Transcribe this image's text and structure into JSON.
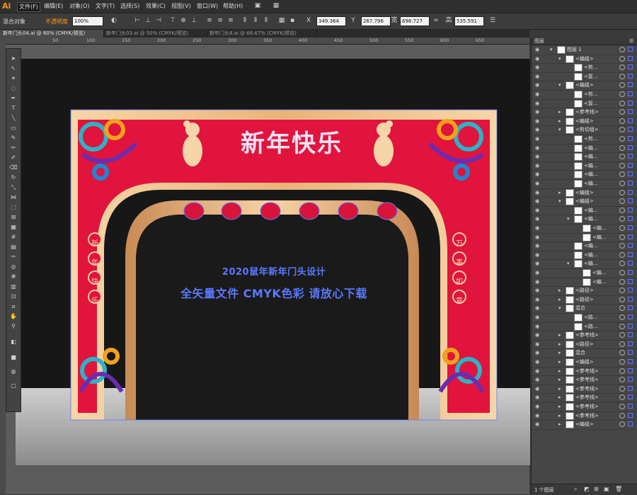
{
  "menubar": {
    "logo": "Ai",
    "items": [
      "文件(F)",
      "编辑(E)",
      "对象(O)",
      "文字(T)",
      "选择(S)",
      "效果(C)",
      "视图(V)",
      "窗口(W)",
      "帮助(H)"
    ]
  },
  "controlbar": {
    "selection_label": "混合对象",
    "opacity_label": "不透明度",
    "opacity_value": "100%",
    "x_label": "X",
    "x_value": "349.364",
    "y_label": "Y",
    "y_value": "267.796",
    "w_label": "宽",
    "w_value": "698.727",
    "h_label": "高",
    "h_value": "535.591"
  },
  "tabs": [
    "新年门头04.ai @ 60% (CMYK/预览)",
    "新年门头03.ai @ 50% (CMYK/预览)",
    "新年门头8.ai @ 66.67% (CMYK/预览)"
  ],
  "ruler": [
    "50",
    "100",
    "150",
    "200",
    "250",
    "300",
    "350",
    "400",
    "450",
    "500",
    "550",
    "600",
    "650"
  ],
  "artwork": {
    "title_text": "新年快乐",
    "left_couplet": [
      "新",
      "年",
      "快",
      "乐"
    ],
    "right_couplet": [
      "万",
      "事",
      "如",
      "意"
    ],
    "selection_line1": "2020鼠年新年门头设计",
    "selection_line2": "全矢量文件 CMYK色彩 请放心下载"
  },
  "layers_panel": {
    "title": "图层",
    "status": "1 个图层",
    "rows": [
      {
        "label": "图层 1",
        "indent": 0,
        "expanded": true
      },
      {
        "label": "<编组>",
        "indent": 1,
        "expanded": true
      },
      {
        "label": "<剪...",
        "indent": 2,
        "expanded": false
      },
      {
        "label": "<复...",
        "indent": 2,
        "expanded": false
      },
      {
        "label": "<编组>",
        "indent": 1,
        "expanded": true
      },
      {
        "label": "<剪...",
        "indent": 2,
        "expanded": false
      },
      {
        "label": "<复...",
        "indent": 2,
        "expanded": false
      },
      {
        "label": "<参考线>",
        "indent": 1,
        "expanded": false
      },
      {
        "label": "<编组>",
        "indent": 1,
        "expanded": false
      },
      {
        "label": "<剪切组>",
        "indent": 1,
        "expanded": true
      },
      {
        "label": "<剪...",
        "indent": 2,
        "expanded": false
      },
      {
        "label": "<编...",
        "indent": 2,
        "expanded": false
      },
      {
        "label": "<编...",
        "indent": 2,
        "expanded": false
      },
      {
        "label": "<编...",
        "indent": 2,
        "expanded": false
      },
      {
        "label": "<编...",
        "indent": 2,
        "expanded": false
      },
      {
        "label": "<编...",
        "indent": 2,
        "expanded": false
      },
      {
        "label": "<编组>",
        "indent": 1,
        "expanded": false
      },
      {
        "label": "<编组>",
        "indent": 1,
        "expanded": true
      },
      {
        "label": "<编...",
        "indent": 2,
        "expanded": false
      },
      {
        "label": "<编...",
        "indent": 2,
        "expanded": true
      },
      {
        "label": "<编...",
        "indent": 3,
        "expanded": false
      },
      {
        "label": "<编...",
        "indent": 3,
        "expanded": false
      },
      {
        "label": "<编...",
        "indent": 2,
        "expanded": false
      },
      {
        "label": "<编...",
        "indent": 2,
        "expanded": false
      },
      {
        "label": "<编...",
        "indent": 2,
        "expanded": true
      },
      {
        "label": "<编...",
        "indent": 3,
        "expanded": false
      },
      {
        "label": "<编...",
        "indent": 3,
        "expanded": false
      },
      {
        "label": "<路径>",
        "indent": 1,
        "expanded": false
      },
      {
        "label": "<路径>",
        "indent": 1,
        "expanded": false
      },
      {
        "label": "混合",
        "indent": 1,
        "expanded": true
      },
      {
        "label": "<路...",
        "indent": 2,
        "expanded": false
      },
      {
        "label": "<路...",
        "indent": 2,
        "expanded": false
      },
      {
        "label": "<参考线>",
        "indent": 1,
        "expanded": false
      },
      {
        "label": "<路径>",
        "indent": 1,
        "expanded": false
      },
      {
        "label": "混合",
        "indent": 1,
        "expanded": false
      },
      {
        "label": "<编组>",
        "indent": 1,
        "expanded": false
      },
      {
        "label": "<参考线>",
        "indent": 1,
        "expanded": false
      },
      {
        "label": "<参考线>",
        "indent": 1,
        "expanded": false
      },
      {
        "label": "<参考线>",
        "indent": 1,
        "expanded": false
      },
      {
        "label": "<参考线>",
        "indent": 1,
        "expanded": false
      },
      {
        "label": "<参考线>",
        "indent": 1,
        "expanded": false
      },
      {
        "label": "<参考线>",
        "indent": 1,
        "expanded": false
      },
      {
        "label": "<编组>",
        "indent": 1,
        "expanded": false
      }
    ]
  },
  "colors": {
    "accent": "#ff9a00",
    "selection": "#5b78ff",
    "arch_red": "#e0143c",
    "arch_gold": "#f2c9a0"
  }
}
